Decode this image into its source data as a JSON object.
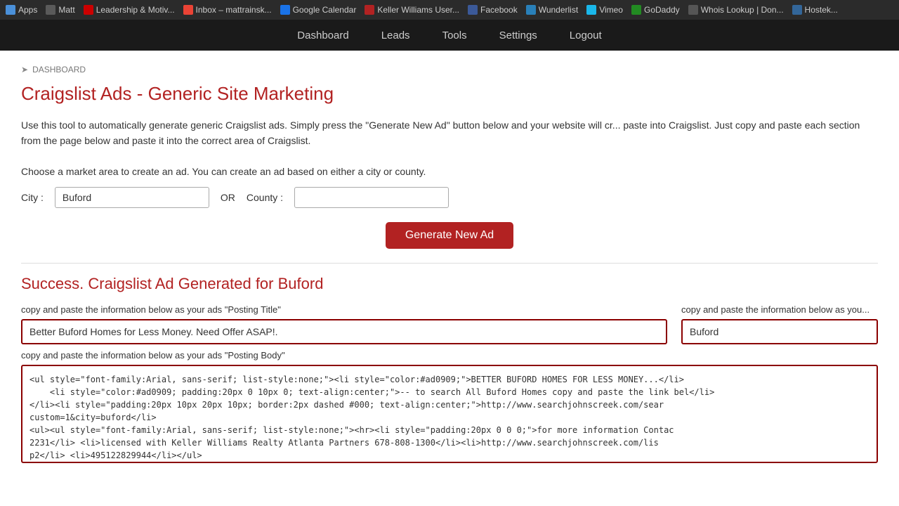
{
  "browser": {
    "tabs": [
      {
        "label": "Apps",
        "favicon_class": "apps"
      },
      {
        "label": "Matt",
        "favicon_class": "matt"
      },
      {
        "label": "Leadership & Motiv...",
        "favicon_class": "leadership"
      },
      {
        "label": "Inbox – mattrainsk...",
        "favicon_class": "gmail"
      },
      {
        "label": "Google Calendar",
        "favicon_class": "gcal"
      },
      {
        "label": "Keller Williams User...",
        "favicon_class": "kw"
      },
      {
        "label": "Facebook",
        "favicon_class": "facebook"
      },
      {
        "label": "Wunderlist",
        "favicon_class": "wunderlist"
      },
      {
        "label": "Vimeo",
        "favicon_class": "vimeo"
      },
      {
        "label": "GoDaddy",
        "favicon_class": "godaddy"
      },
      {
        "label": "Whois Lookup | Don...",
        "favicon_class": "whois"
      },
      {
        "label": "Hostek...",
        "favicon_class": "hostek"
      }
    ]
  },
  "nav": {
    "items": [
      {
        "label": "Dashboard",
        "key": "dashboard"
      },
      {
        "label": "Leads",
        "key": "leads"
      },
      {
        "label": "Tools",
        "key": "tools"
      },
      {
        "label": "Settings",
        "key": "settings"
      },
      {
        "label": "Logout",
        "key": "logout"
      }
    ]
  },
  "breadcrumb": {
    "arrow": "➤",
    "label": "DASHBOARD"
  },
  "page": {
    "title": "Craigslist Ads - Generic Site Marketing",
    "description": "Use this tool to automatically generate generic Craigslist ads. Simply press the \"Generate New Ad\" button below and your website will cr... paste into Craigslist. Just copy and paste each section from the page below and paste it into the correct area of Craigslist.",
    "market_instruction": "Choose a market area to create an ad. You can create an ad based on either a city or county.",
    "city_label": "City :",
    "city_value": "Buford",
    "city_placeholder": "",
    "or_label": "OR",
    "county_label": "County :",
    "county_value": "",
    "county_placeholder": "",
    "generate_button": "Generate New Ad",
    "success_title": "Success. Craigslist Ad Generated for Buford",
    "posting_title_label": "copy and paste the information below as your ads \"Posting Title\"",
    "posting_title_value": "Better Buford Homes for Less Money. Need Offer ASAP!.",
    "posting_location_label": "copy and paste the information below as you...",
    "posting_location_value": "Buford",
    "posting_body_label": "copy and paste the information below as your ads \"Posting Body\"",
    "posting_body_value": "<ul style=\"font-family:Arial, sans-serif; list-style:none;\"><li style=\"color:#ad0909;\">BETTER BUFORD HOMES FOR LESS MONEY...</li>\n    <li style=\"color:#ad0909; padding:20px 0 10px 0; text-align:center;\">-- to search All Buford Homes copy and paste the link bel</li>\n</li><li style=\"padding:20px 10px 20px 10px; border:2px dashed #000; text-align:center;\">http://www.searchjohnscreek.com/sear\ncustom=1&city=buford</li>\n<ul><ul style=\"font-family:Arial, sans-serif; list-style:none;\"><hr><li style=\"padding:20px 0 0 0;\">for more information Contac\n2231</li> <li>licensed with Keller Williams Realty Atlanta Partners 678-808-1300</li><li>http://www.searchjohnscreek.com/lis\np2</li> <li>495122829944</li></ul>"
  }
}
